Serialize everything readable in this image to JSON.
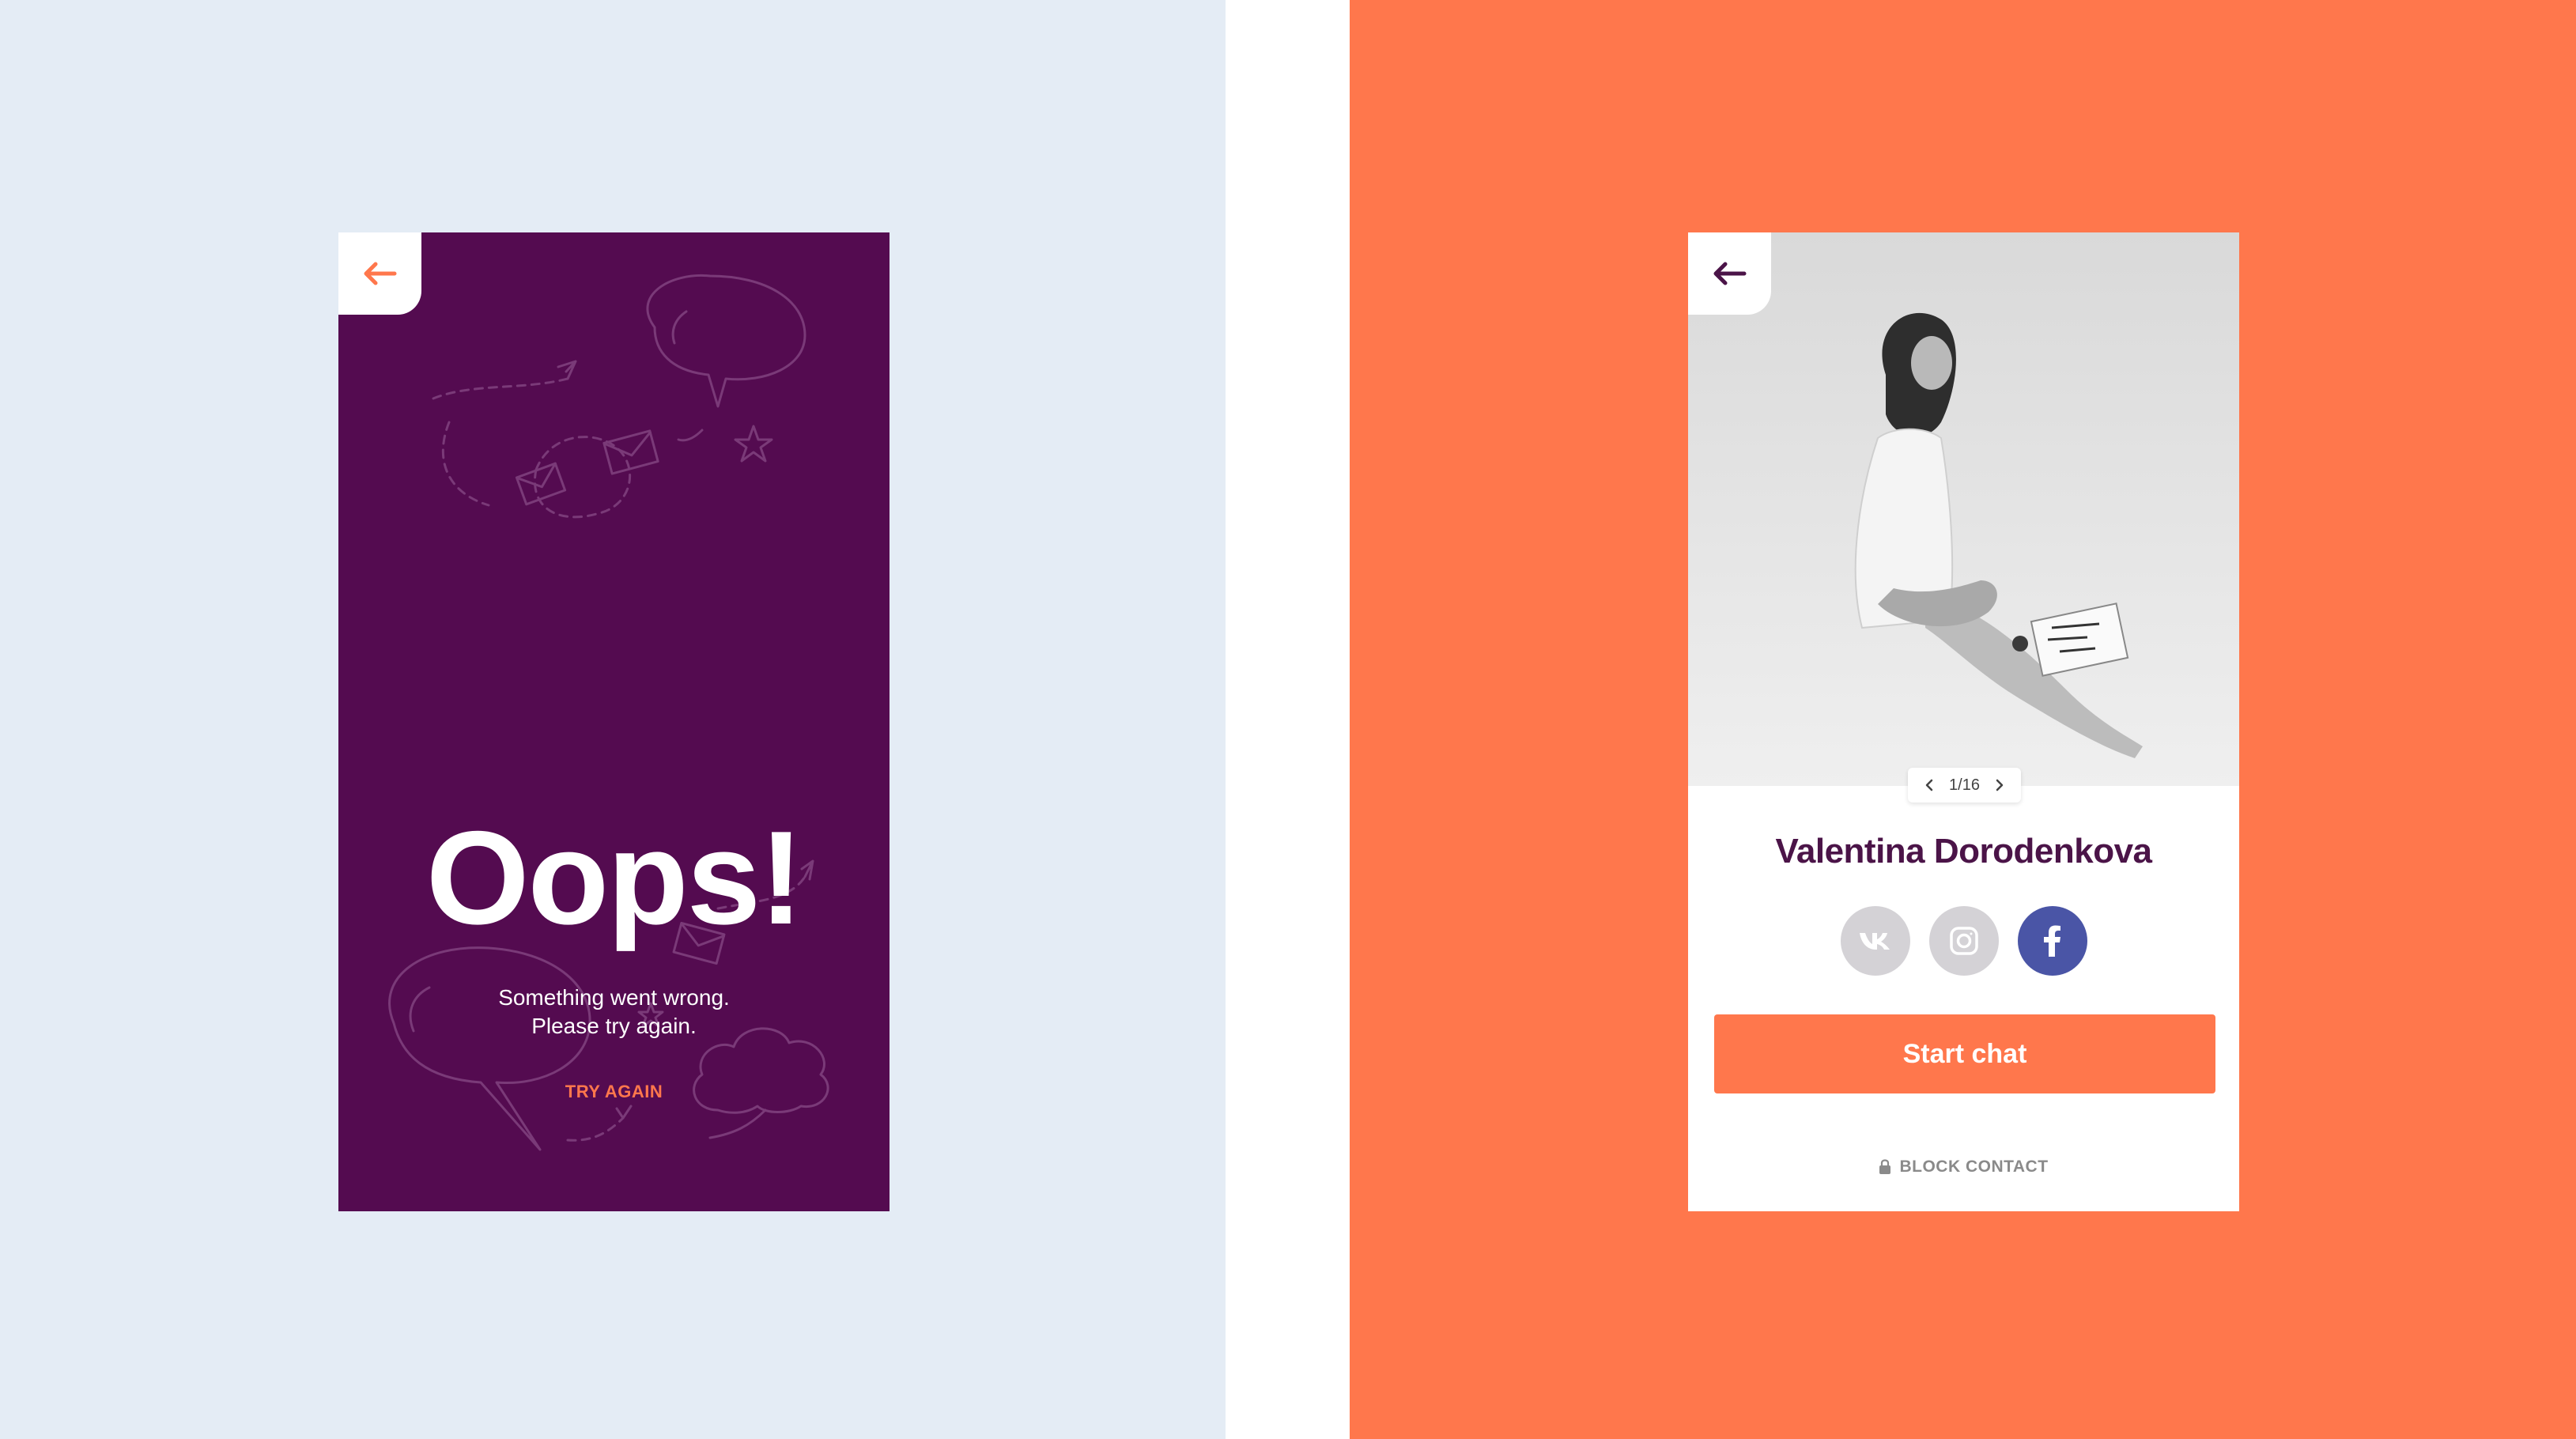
{
  "colors": {
    "left_background": "#e4ecf5",
    "right_background": "#ff774c",
    "error_card": "#540b50",
    "accent": "#ff774c",
    "name_color": "#4b1448",
    "facebook": "#4a55a6",
    "social_inactive": "#d4d2d6"
  },
  "error_screen": {
    "back_icon": "arrow-left-icon",
    "title": "Oops!",
    "message_line1": "Something went wrong.",
    "message_line2": "Please try again.",
    "try_again_label": "TRY AGAIN"
  },
  "profile_screen": {
    "back_icon": "arrow-left-icon",
    "photo_description_icon": "photo",
    "pager": {
      "text": "1/16",
      "prev_icon": "chevron-left-icon",
      "next_icon": "chevron-right-icon"
    },
    "name": "Valentina Dorodenkova",
    "socials": [
      {
        "icon": "vk-icon"
      },
      {
        "icon": "instagram-icon"
      },
      {
        "icon": "facebook-icon"
      }
    ],
    "start_chat_label": "Start chat",
    "block_contact_label": "BLOCK CONTACT",
    "block_icon": "lock-icon"
  }
}
